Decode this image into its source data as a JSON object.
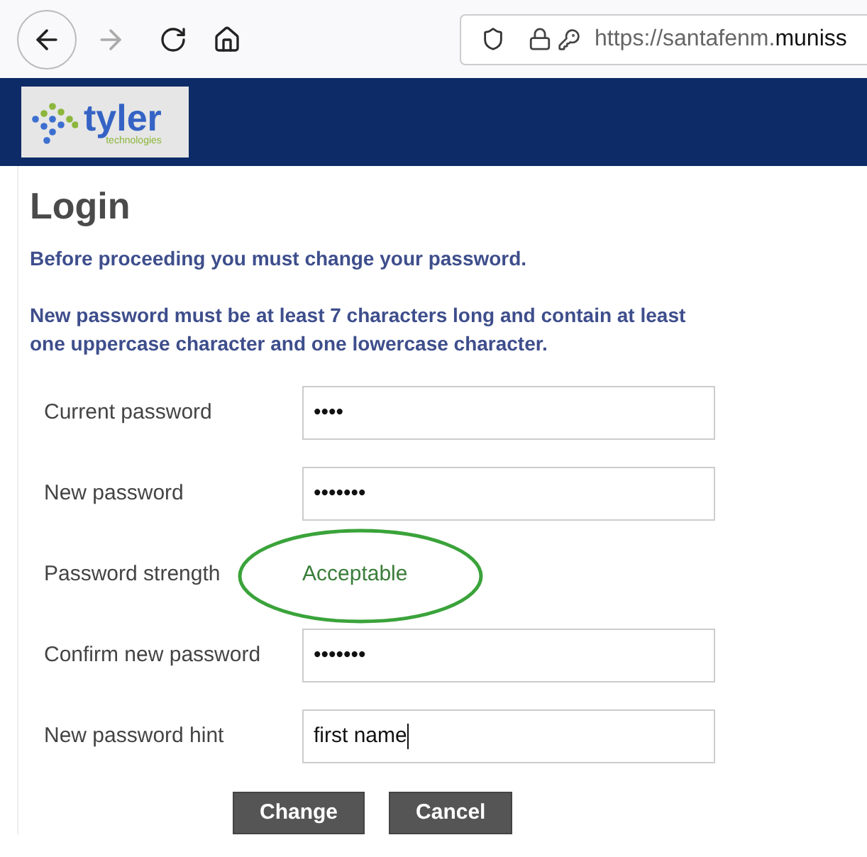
{
  "browser": {
    "back": {
      "disabled": false
    },
    "forward": {
      "disabled": true
    },
    "url_host_start": "https://santafenm.",
    "url_host_rest": "muniss"
  },
  "logo": {
    "name": "tyler",
    "tagline": "technologies"
  },
  "page": {
    "title": "Login",
    "notice": "Before proceeding you must change your password.",
    "rules": "New password must be at least 7 characters long and contain at least one uppercase character and one lowercase character."
  },
  "form": [
    {
      "kind": "field",
      "label": "Current password",
      "value": "••••"
    },
    {
      "kind": "field",
      "label": "New password",
      "value": "•••••••"
    },
    {
      "kind": "strength",
      "label": "Password strength",
      "value": "Acceptable",
      "highlighted": true
    },
    {
      "kind": "field",
      "label": "Confirm new password",
      "value": "•••••••"
    },
    {
      "kind": "field",
      "label": "New password hint",
      "value": "first name",
      "focused": true
    }
  ],
  "buttons": [
    "Change",
    "Cancel"
  ]
}
